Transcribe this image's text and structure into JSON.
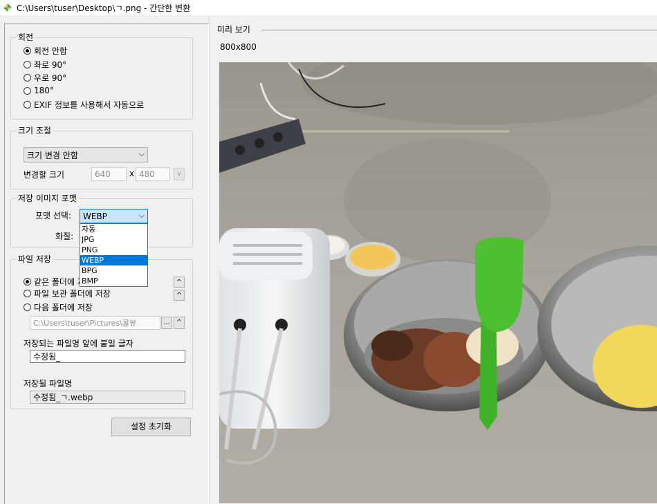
{
  "window": {
    "title": "C:\\Users\\tuser\\Desktop\\ㄱ.png - 간단한 변환"
  },
  "rotation": {
    "legend": "회전",
    "options": [
      {
        "label": "회전 안함",
        "checked": true
      },
      {
        "label": "좌로 90°",
        "checked": false
      },
      {
        "label": "우로 90°",
        "checked": false
      },
      {
        "label": "180°",
        "checked": false
      },
      {
        "label": "EXIF 정보를 사용해서 자동으로",
        "checked": false
      }
    ]
  },
  "resize": {
    "legend": "크기 조절",
    "mode_value": "크기 변경 안함",
    "size_label": "변경할 크기",
    "width": "640",
    "separator": "x",
    "height": "480",
    "dropdown_button": "v"
  },
  "format": {
    "legend": "저장 이미지 포맷",
    "select_label": "포맷 선택:",
    "selected": "WEBP",
    "quality_label": "화질:",
    "options": [
      "자동",
      "JPG",
      "PNG",
      "WEBP",
      "BPG",
      "BMP"
    ],
    "highlighted_index": 3
  },
  "save": {
    "legend": "파일 저장",
    "options": [
      {
        "label": "같은 폴더에 저장",
        "checked": true
      },
      {
        "label": "파일 보관 폴더에 저장",
        "checked": false
      },
      {
        "label": "다음 폴더에 저장",
        "checked": false
      }
    ],
    "folder_path": "C:\\Users\\tuser\\Pictures\\꿀뷰",
    "browse_label": "...",
    "up_label": "^",
    "prefix_label": "저장되는 파일명 앞에 붙일 글자",
    "prefix_value": "수정됨_",
    "filename_label": "저장될 파일명",
    "filename_value": "수정됨_ㄱ.webp"
  },
  "reset_button": "설정 초기화",
  "preview": {
    "legend": "미리 보기",
    "dimensions": "800x800"
  },
  "colors": {
    "selection": "#0078d7",
    "combo_active": "#cce4f7",
    "spatula_green": "#4cbf32",
    "counter": "#a7a49c"
  }
}
